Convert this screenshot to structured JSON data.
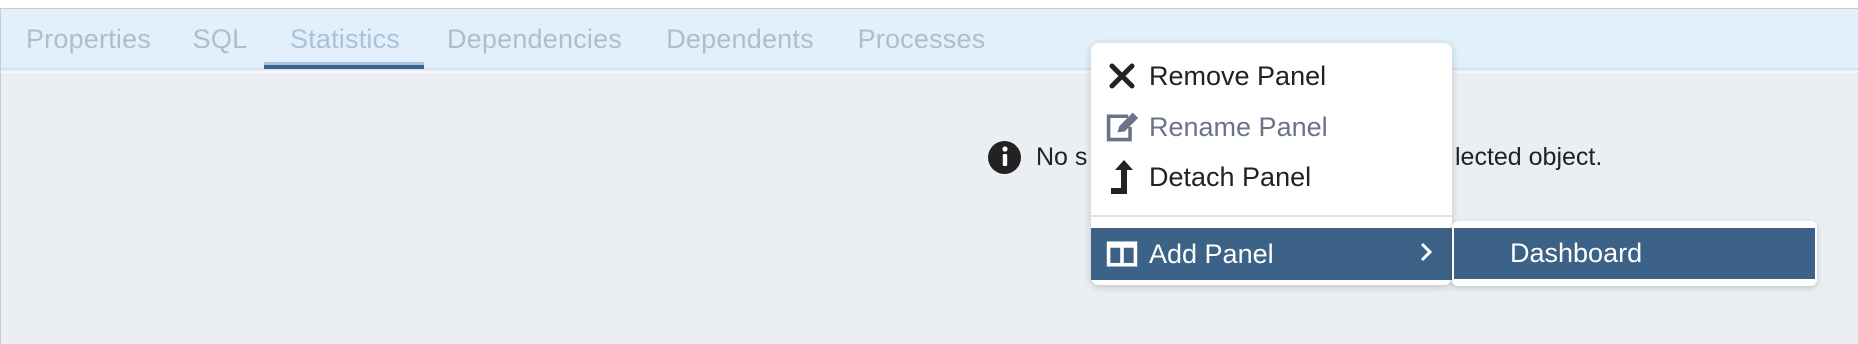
{
  "tabs": [
    {
      "label": "Properties"
    },
    {
      "label": "SQL"
    },
    {
      "label": "Statistics",
      "active": true
    },
    {
      "label": "Dependencies"
    },
    {
      "label": "Dependents"
    },
    {
      "label": "Processes"
    }
  ],
  "content": {
    "message_start": "No s",
    "message_end": "lected object.",
    "icon": "info-icon"
  },
  "context_menu": {
    "items": [
      {
        "label": "Remove Panel",
        "icon": "close-icon",
        "disabled": false
      },
      {
        "label": "Rename Panel",
        "icon": "edit-icon",
        "disabled": true
      },
      {
        "label": "Detach Panel",
        "icon": "detach-icon",
        "disabled": false
      },
      {
        "label": "Add Panel",
        "icon": "columns-icon",
        "selected": true,
        "has_submenu": true
      }
    ],
    "submenu": {
      "items": [
        {
          "label": "Dashboard",
          "selected": true
        }
      ]
    }
  },
  "colors": {
    "accent": "#3d6288",
    "tabbar_bg": "#e1f0fa",
    "panel_bg": "#ebeef3",
    "tab_text": "#aebfcc"
  }
}
